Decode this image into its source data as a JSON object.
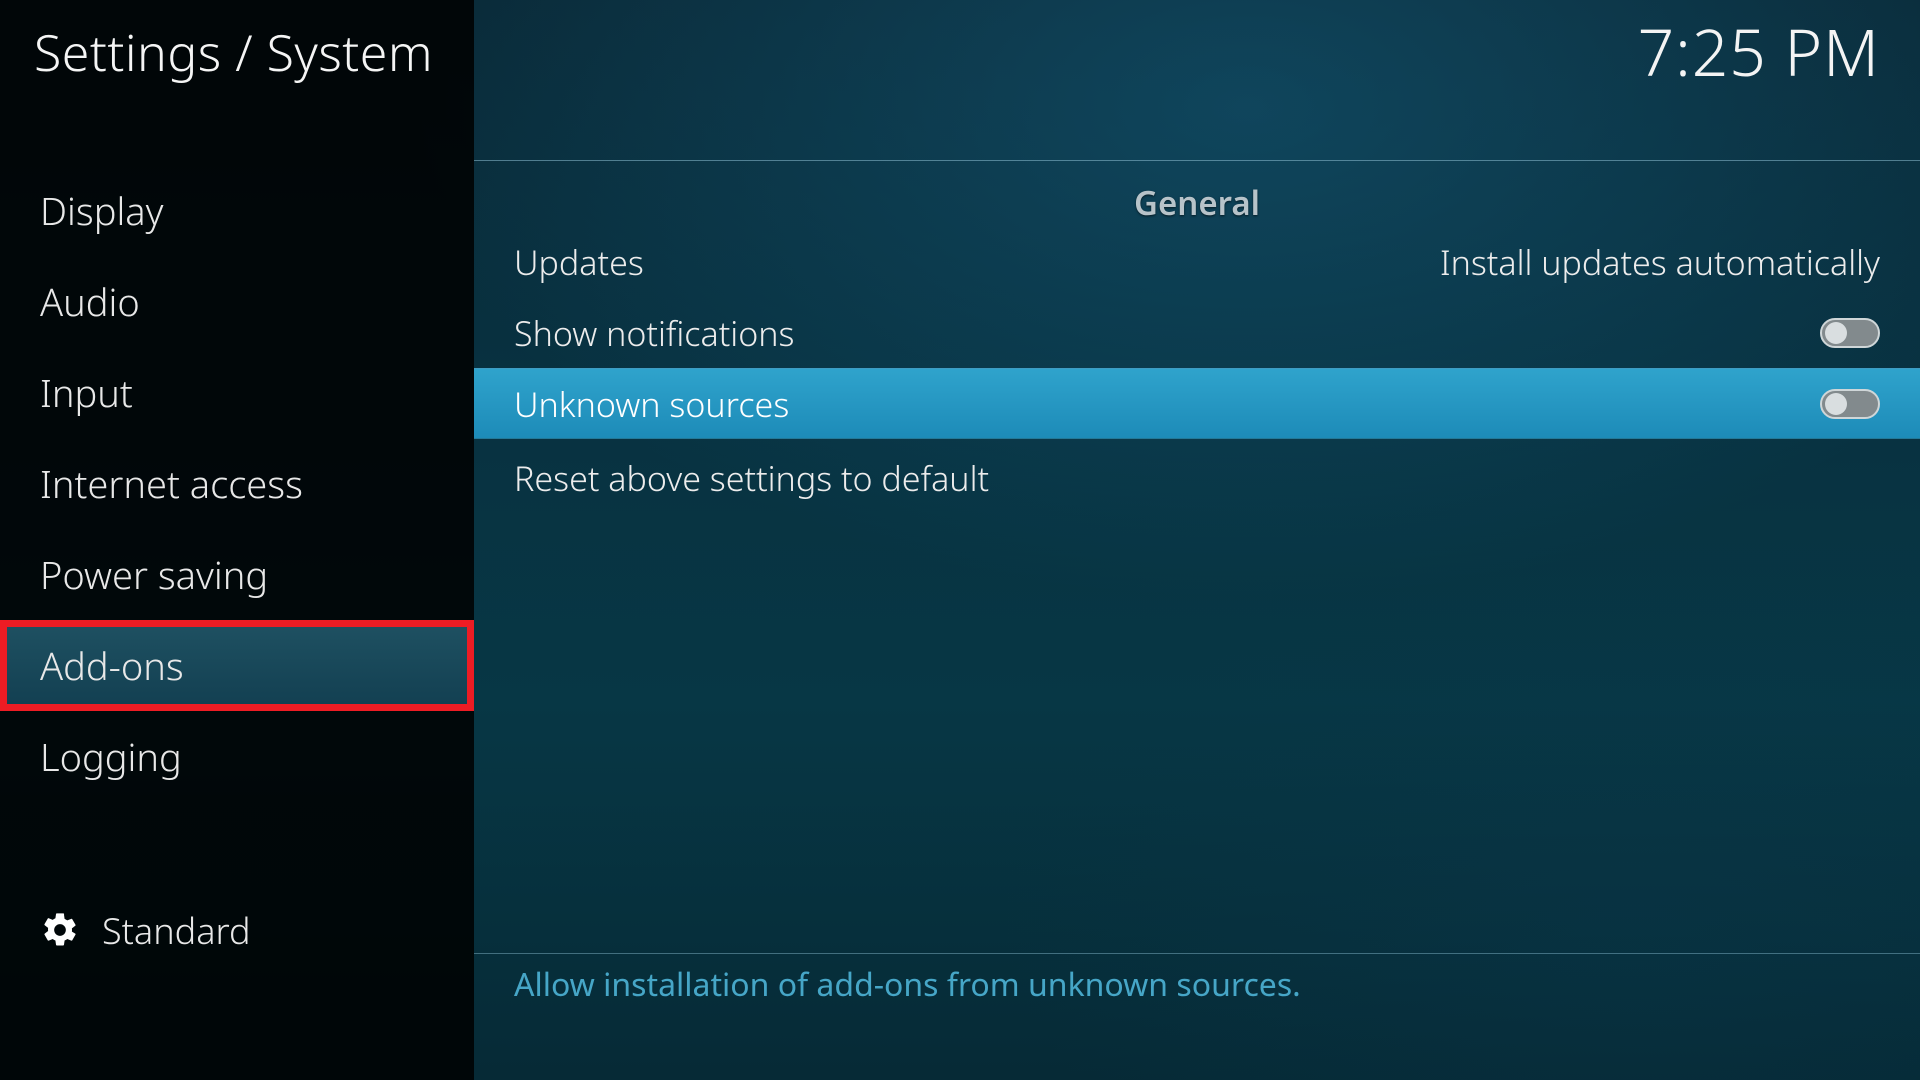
{
  "breadcrumb": "Settings / System",
  "clock": "7:25 PM",
  "sidebar": {
    "items": [
      {
        "label": "Display"
      },
      {
        "label": "Audio"
      },
      {
        "label": "Input"
      },
      {
        "label": "Internet access"
      },
      {
        "label": "Power saving"
      },
      {
        "label": "Add-ons"
      },
      {
        "label": "Logging"
      }
    ],
    "selected_index": 5,
    "level_label": "Standard"
  },
  "section_header": "General",
  "settings": {
    "updates": {
      "label": "Updates",
      "value": "Install updates automatically"
    },
    "show_notifications": {
      "label": "Show notifications",
      "on": false
    },
    "unknown_sources": {
      "label": "Unknown sources",
      "on": false
    },
    "reset": {
      "label": "Reset above settings to default"
    }
  },
  "help_text": "Allow installation of add-ons from unknown sources."
}
